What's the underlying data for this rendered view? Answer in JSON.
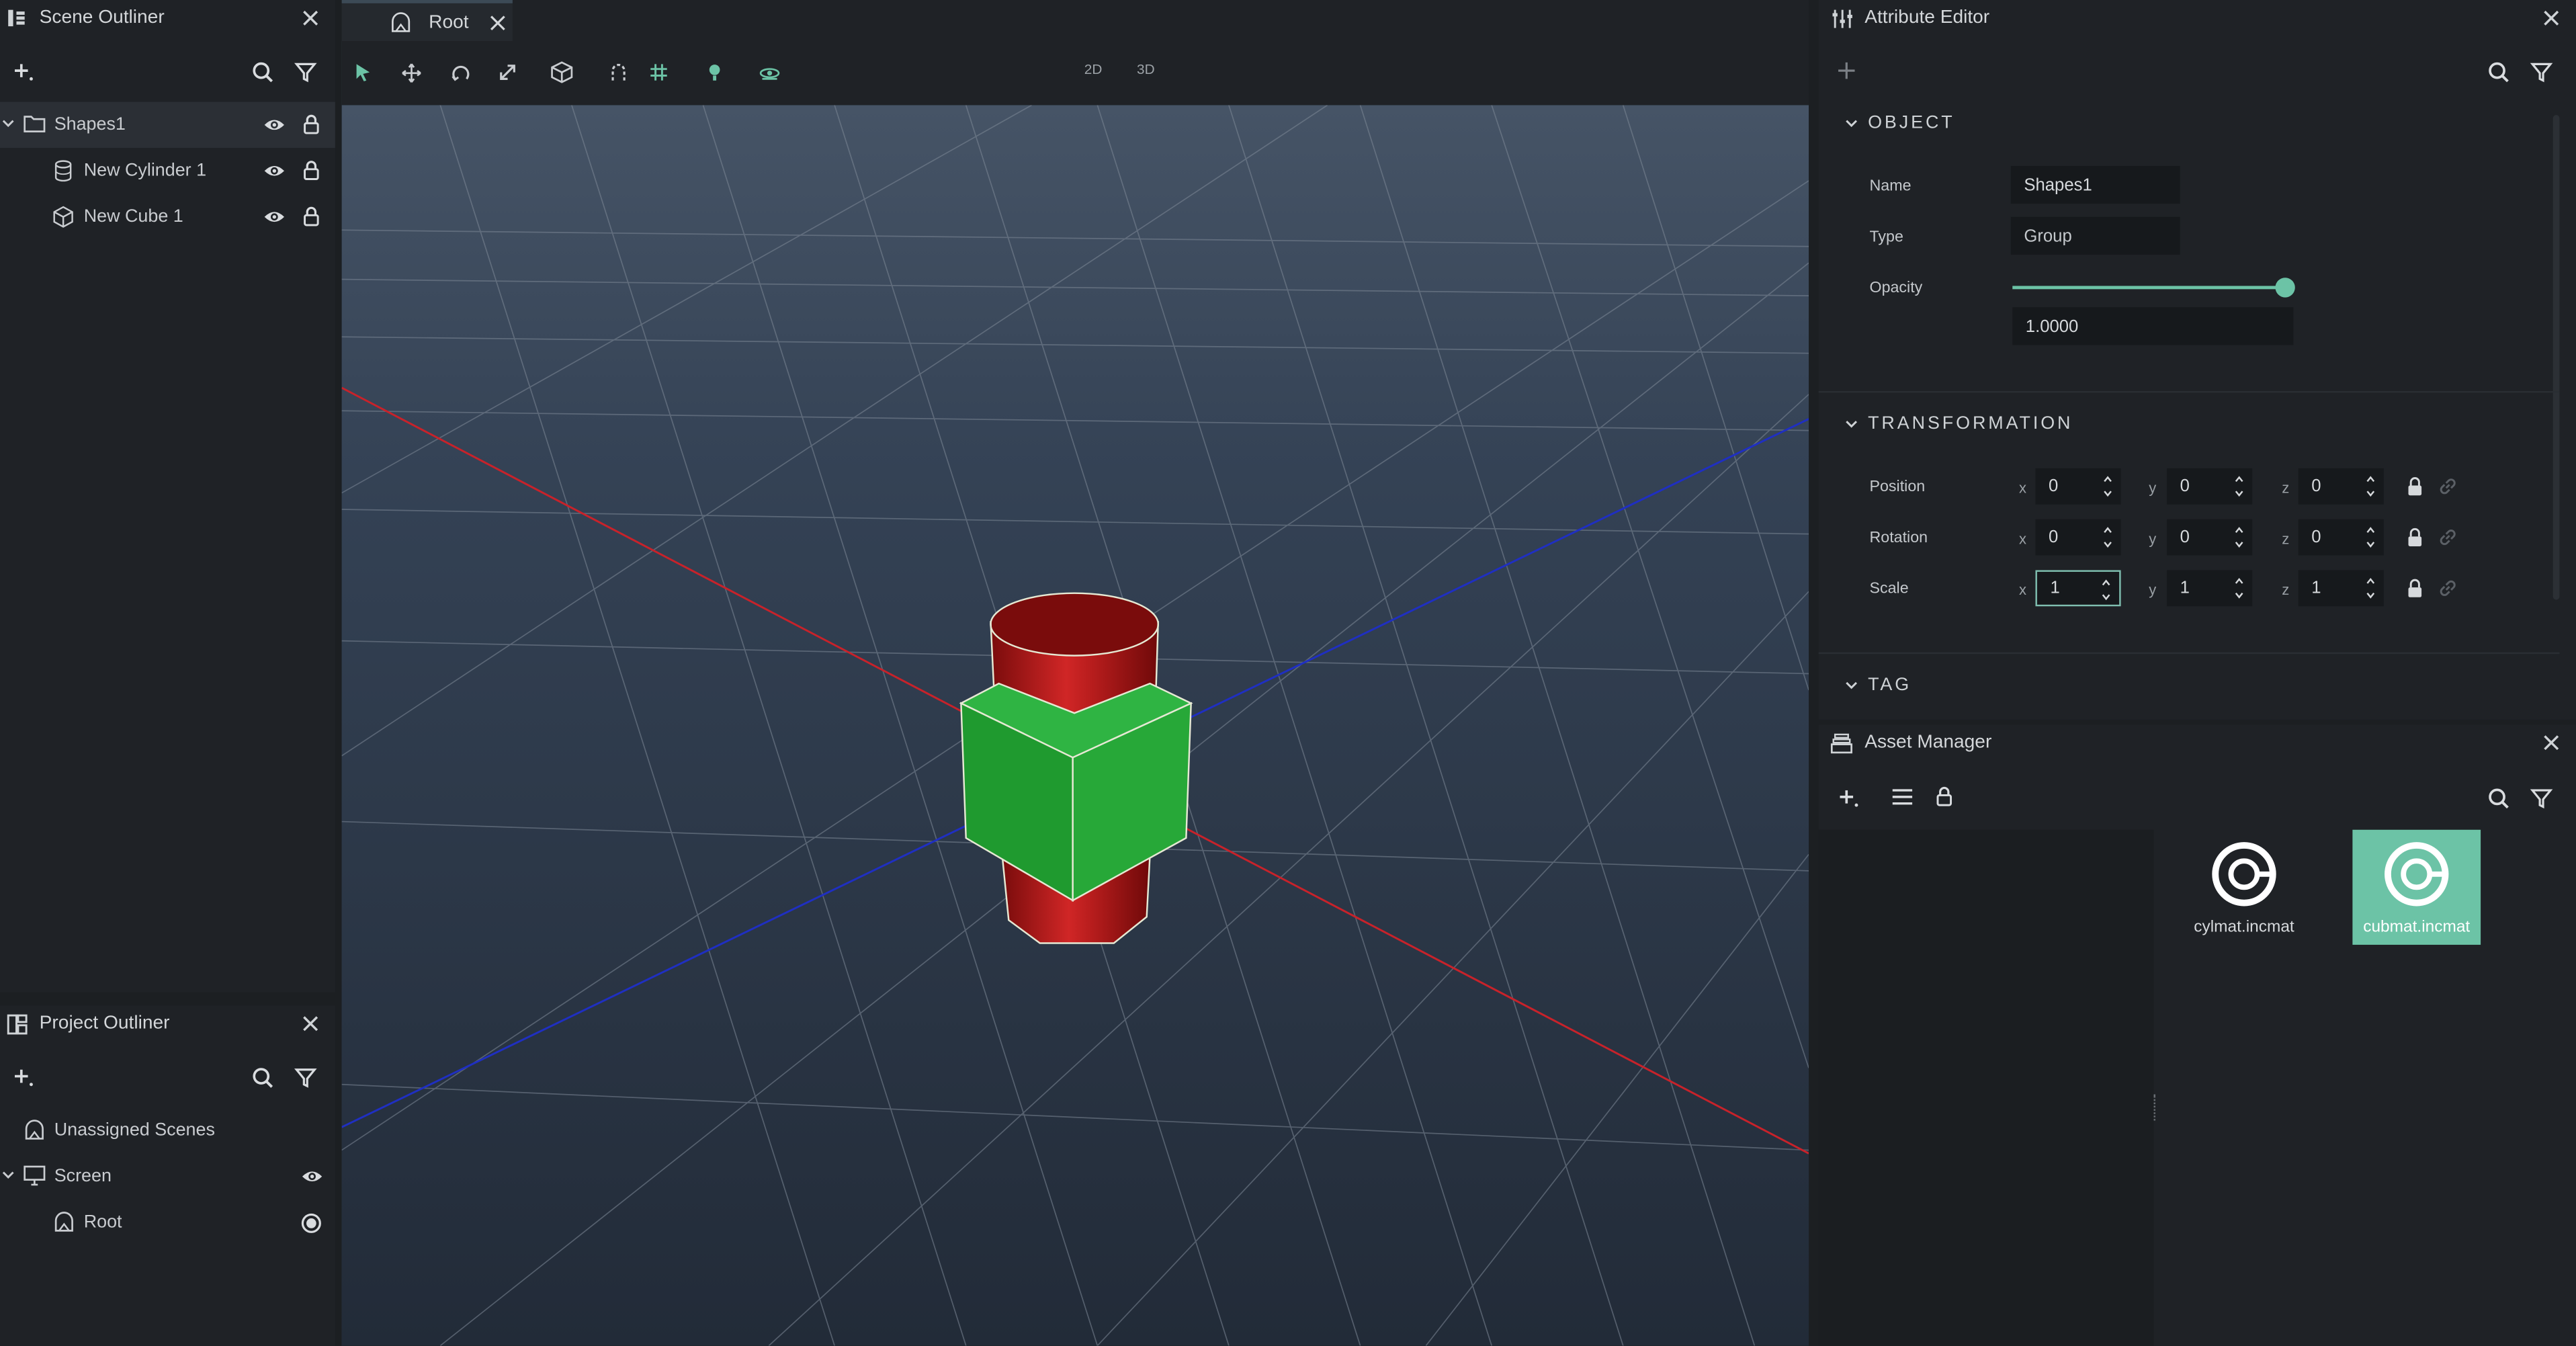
{
  "scene_outliner": {
    "title": "Scene Outliner",
    "items": [
      {
        "label": "Shapes1"
      },
      {
        "label": "New Cylinder 1"
      },
      {
        "label": "New Cube 1"
      }
    ]
  },
  "project_outliner": {
    "title": "Project Outliner",
    "items": [
      {
        "label": "Unassigned Scenes"
      },
      {
        "label": "Screen"
      },
      {
        "label": "Root"
      }
    ]
  },
  "viewport": {
    "tab_label": "Root",
    "mode_2d": "2D",
    "mode_3d": "3D"
  },
  "attribute_editor": {
    "title": "Attribute Editor",
    "object_section": "OBJECT",
    "name_label": "Name",
    "name_value": "Shapes1",
    "type_label": "Type",
    "type_value": "Group",
    "opacity_label": "Opacity",
    "opacity_value": "1.0000",
    "opacity_fraction": 1.0,
    "transform_section": "TRANSFORMATION",
    "position_label": "Position",
    "rotation_label": "Rotation",
    "scale_label": "Scale",
    "axis_x": "x",
    "axis_y": "y",
    "axis_z": "z",
    "position": {
      "x": "0",
      "y": "0",
      "z": "0"
    },
    "rotation": {
      "x": "0",
      "y": "0",
      "z": "0"
    },
    "scale": {
      "x": "1",
      "y": "1",
      "z": "1"
    },
    "tag_section": "TAG"
  },
  "asset_manager": {
    "title": "Asset Manager",
    "assets": [
      {
        "label": "cylmat.incmat"
      },
      {
        "label": "cubmat.incmat"
      }
    ]
  },
  "colors": {
    "accent": "#6cc3a6",
    "panel_bg": "#1f2226",
    "viewport_bg": "#2a3646",
    "cylinder_red": "#b01818",
    "cube_green": "#219a32"
  }
}
